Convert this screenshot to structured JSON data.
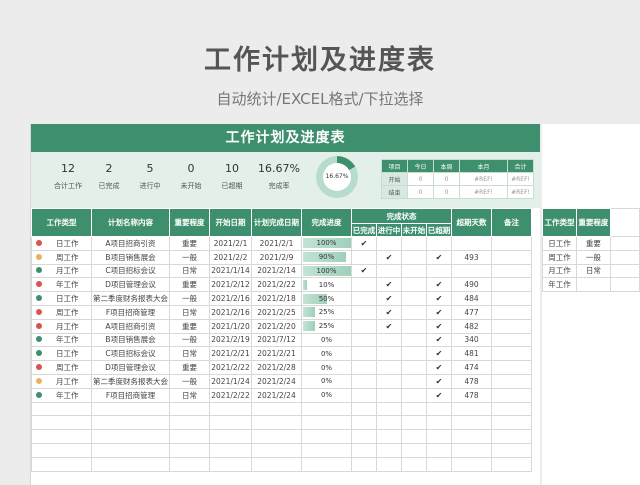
{
  "header": {
    "title": "工作计划及进度表",
    "subtitle": "自动统计/EXCEL格式/下拉选择"
  },
  "sheet": {
    "banner": "工作计划及进度表",
    "stats": [
      {
        "value": "12",
        "label": "合计工作"
      },
      {
        "value": "2",
        "label": "已完成"
      },
      {
        "value": "5",
        "label": "进行中"
      },
      {
        "value": "0",
        "label": "未开始"
      },
      {
        "value": "10",
        "label": "已超期"
      },
      {
        "value": "16.67%",
        "label": "完成率"
      }
    ],
    "donut_label": "16.67%",
    "donut_fraction": 0.1667,
    "mini_table": {
      "headers": [
        "项目",
        "今日",
        "本周",
        "本月",
        "合计"
      ],
      "rows": [
        [
          "开始",
          "0",
          "0",
          "#REF!",
          "#REF!"
        ],
        [
          "结束",
          "0",
          "0",
          "#REF!",
          "#REF!"
        ]
      ]
    },
    "columns": {
      "type": "工作类型",
      "name": "计划名称内容",
      "importance": "重要程度",
      "start": "开始日期",
      "end": "计划完成日期",
      "progress": "完成进度",
      "status_group": "完成状态",
      "done": "已完成",
      "ongoing": "进行中",
      "notstarted": "未开始",
      "overdue": "已超期",
      "overdue_days": "超期天数",
      "note": "备注"
    },
    "check_mark": "✔",
    "colors": {
      "accent": "#3d8f6d",
      "important": "#d03a2e",
      "normal": "#2f8d62",
      "daily": "#555555",
      "dot_red": "#d9534f",
      "dot_yellow": "#e8b35e",
      "dot_green": "#3d8f6d"
    },
    "rows": [
      {
        "dot": "red",
        "type": "日工作",
        "name": "A项目招商引资",
        "importance": "重要",
        "imp": "red",
        "start": "2021/2/1",
        "end": "2021/2/1",
        "progress": "100%",
        "pct": 100,
        "done": true,
        "ongoing": false,
        "notstarted": false,
        "overdue": false,
        "days": ""
      },
      {
        "dot": "yellow",
        "type": "周工作",
        "name": "B项目销售展会",
        "importance": "一般",
        "imp": "green",
        "start": "2021/2/2",
        "end": "2021/2/9",
        "progress": "90%",
        "pct": 90,
        "done": false,
        "ongoing": true,
        "notstarted": false,
        "overdue": true,
        "days": "493"
      },
      {
        "dot": "green",
        "type": "月工作",
        "name": "C项目招标会议",
        "importance": "日常",
        "imp": "gray",
        "start": "2021/1/14",
        "end": "2021/2/14",
        "progress": "100%",
        "pct": 100,
        "done": true,
        "ongoing": false,
        "notstarted": false,
        "overdue": false,
        "days": ""
      },
      {
        "dot": "red",
        "type": "年工作",
        "name": "D项目管理会议",
        "importance": "重要",
        "imp": "red",
        "start": "2021/2/12",
        "end": "2021/2/22",
        "progress": "10%",
        "pct": 10,
        "done": false,
        "ongoing": true,
        "notstarted": false,
        "overdue": true,
        "days": "490"
      },
      {
        "dot": "green",
        "type": "日工作",
        "name": "第二季度财务报表大会",
        "importance": "一般",
        "imp": "green",
        "start": "2021/2/16",
        "end": "2021/2/18",
        "progress": "50%",
        "pct": 50,
        "done": false,
        "ongoing": true,
        "notstarted": false,
        "overdue": true,
        "days": "484"
      },
      {
        "dot": "red",
        "type": "周工作",
        "name": "F项目招商管理",
        "importance": "日常",
        "imp": "gray",
        "start": "2021/2/16",
        "end": "2021/2/25",
        "progress": "25%",
        "pct": 25,
        "done": false,
        "ongoing": true,
        "notstarted": false,
        "overdue": true,
        "days": "477"
      },
      {
        "dot": "red",
        "type": "月工作",
        "name": "A项目招商引资",
        "importance": "重要",
        "imp": "red",
        "start": "2021/1/20",
        "end": "2021/2/20",
        "progress": "25%",
        "pct": 25,
        "done": false,
        "ongoing": true,
        "notstarted": false,
        "overdue": true,
        "days": "482"
      },
      {
        "dot": "green",
        "type": "年工作",
        "name": "B项目销售展会",
        "importance": "一般",
        "imp": "green",
        "start": "2021/2/19",
        "end": "2021/7/12",
        "progress": "0%",
        "pct": 0,
        "done": false,
        "ongoing": false,
        "notstarted": false,
        "overdue": true,
        "days": "340"
      },
      {
        "dot": "green",
        "type": "日工作",
        "name": "C项目招标会议",
        "importance": "日常",
        "imp": "gray",
        "start": "2021/2/21",
        "end": "2021/2/21",
        "progress": "0%",
        "pct": 0,
        "done": false,
        "ongoing": false,
        "notstarted": false,
        "overdue": true,
        "days": "481"
      },
      {
        "dot": "red",
        "type": "周工作",
        "name": "D项目管理会议",
        "importance": "重要",
        "imp": "red",
        "start": "2021/2/22",
        "end": "2021/2/28",
        "progress": "0%",
        "pct": 0,
        "done": false,
        "ongoing": false,
        "notstarted": false,
        "overdue": true,
        "days": "474"
      },
      {
        "dot": "yellow",
        "type": "月工作",
        "name": "第二季度财务报表大会",
        "importance": "一般",
        "imp": "green",
        "start": "2021/1/24",
        "end": "2021/2/24",
        "progress": "0%",
        "pct": 0,
        "done": false,
        "ongoing": false,
        "notstarted": false,
        "overdue": true,
        "days": "478"
      },
      {
        "dot": "green",
        "type": "年工作",
        "name": "F项目招商管理",
        "importance": "日常",
        "imp": "gray",
        "start": "2021/2/22",
        "end": "2021/2/24",
        "progress": "0%",
        "pct": 0,
        "done": false,
        "ongoing": false,
        "notstarted": false,
        "overdue": true,
        "days": "478"
      }
    ],
    "empty_rows": 5
  },
  "side_sheet": {
    "headers": [
      "工作类型",
      "重要程度"
    ],
    "rows": [
      [
        "日工作",
        "重要"
      ],
      [
        "周工作",
        "一般"
      ],
      [
        "月工作",
        "日常"
      ],
      [
        "年工作",
        ""
      ]
    ]
  }
}
